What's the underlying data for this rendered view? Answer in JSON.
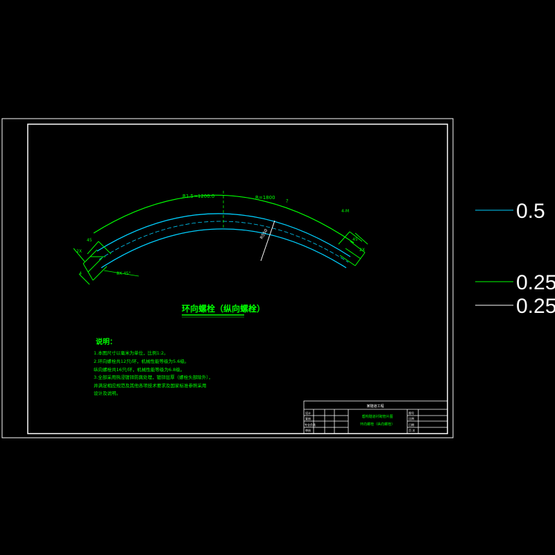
{
  "colors": {
    "background": "#000000",
    "frame": "#ffffff",
    "green": "#00ff00",
    "cyan": "#00d0ff"
  },
  "drawing": {
    "title": "环向螺栓（纵向螺栓）",
    "scale": "1:2",
    "dims": {
      "dim_top_left": "R1.5=1200.0",
      "dim_top_right": "R=1800",
      "dim_top_q": "?",
      "dim_right_mark": "4-M",
      "dim_left_45a": "45",
      "dim_left_mid": "2X",
      "dim_left_end": "4",
      "dim_left_angle": "8X 45°",
      "dim_right_45": "45",
      "dim_right_mid": "2X",
      "dim_radius": "R550"
    }
  },
  "notes": {
    "heading": "说明：",
    "lines": [
      "1.本图尺寸以毫米为单位，比例1:2。",
      "2.环向螺栓共12只/环，机械性能等级为5.6级。",
      "  纵向螺栓共16只/环，机械性能等级为6.8级。",
      "3.全部采用热浸镀锌防腐处理，镀锌层厚（螺栓头部除外），",
      "  并满足相应规范及其他各项技术要求及国家标准参照采用",
      "  设计及说明。"
    ]
  },
  "title_block": {
    "project": "某隧道工程",
    "drawing_title_1": "盾构隧道衬砌管片图",
    "drawing_title_2": "环向螺栓（纵向螺栓）",
    "row_labels": [
      "设计",
      "复核",
      "专业负责",
      "审核"
    ],
    "right_labels": [
      "图号",
      "比例",
      "日期",
      "页 次"
    ]
  },
  "legend": [
    {
      "label": "0.5",
      "color": "#00d0ff"
    },
    {
      "label": "0.25",
      "color": "#00ff00"
    },
    {
      "label": "0.25",
      "color": "#ffffff"
    }
  ]
}
